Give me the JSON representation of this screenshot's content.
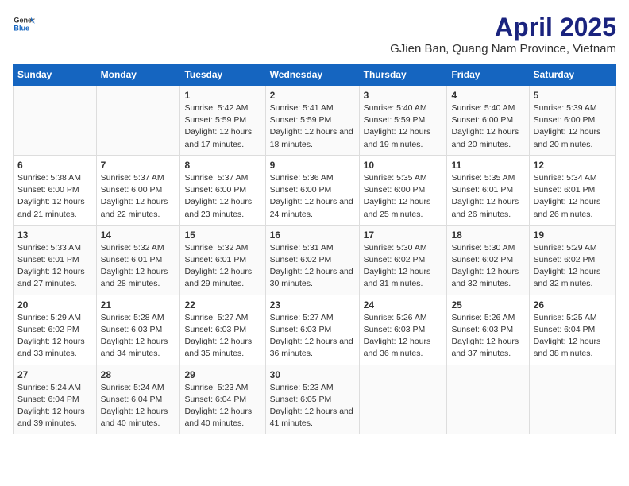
{
  "header": {
    "logo_general": "General",
    "logo_blue": "Blue",
    "title": "April 2025",
    "subtitle": "GJien Ban, Quang Nam Province, Vietnam"
  },
  "days_of_week": [
    "Sunday",
    "Monday",
    "Tuesday",
    "Wednesday",
    "Thursday",
    "Friday",
    "Saturday"
  ],
  "weeks": [
    [
      {
        "day": "",
        "info": ""
      },
      {
        "day": "",
        "info": ""
      },
      {
        "day": "1",
        "info": "Sunrise: 5:42 AM\nSunset: 5:59 PM\nDaylight: 12 hours and 17 minutes."
      },
      {
        "day": "2",
        "info": "Sunrise: 5:41 AM\nSunset: 5:59 PM\nDaylight: 12 hours and 18 minutes."
      },
      {
        "day": "3",
        "info": "Sunrise: 5:40 AM\nSunset: 5:59 PM\nDaylight: 12 hours and 19 minutes."
      },
      {
        "day": "4",
        "info": "Sunrise: 5:40 AM\nSunset: 6:00 PM\nDaylight: 12 hours and 20 minutes."
      },
      {
        "day": "5",
        "info": "Sunrise: 5:39 AM\nSunset: 6:00 PM\nDaylight: 12 hours and 20 minutes."
      }
    ],
    [
      {
        "day": "6",
        "info": "Sunrise: 5:38 AM\nSunset: 6:00 PM\nDaylight: 12 hours and 21 minutes."
      },
      {
        "day": "7",
        "info": "Sunrise: 5:37 AM\nSunset: 6:00 PM\nDaylight: 12 hours and 22 minutes."
      },
      {
        "day": "8",
        "info": "Sunrise: 5:37 AM\nSunset: 6:00 PM\nDaylight: 12 hours and 23 minutes."
      },
      {
        "day": "9",
        "info": "Sunrise: 5:36 AM\nSunset: 6:00 PM\nDaylight: 12 hours and 24 minutes."
      },
      {
        "day": "10",
        "info": "Sunrise: 5:35 AM\nSunset: 6:00 PM\nDaylight: 12 hours and 25 minutes."
      },
      {
        "day": "11",
        "info": "Sunrise: 5:35 AM\nSunset: 6:01 PM\nDaylight: 12 hours and 26 minutes."
      },
      {
        "day": "12",
        "info": "Sunrise: 5:34 AM\nSunset: 6:01 PM\nDaylight: 12 hours and 26 minutes."
      }
    ],
    [
      {
        "day": "13",
        "info": "Sunrise: 5:33 AM\nSunset: 6:01 PM\nDaylight: 12 hours and 27 minutes."
      },
      {
        "day": "14",
        "info": "Sunrise: 5:32 AM\nSunset: 6:01 PM\nDaylight: 12 hours and 28 minutes."
      },
      {
        "day": "15",
        "info": "Sunrise: 5:32 AM\nSunset: 6:01 PM\nDaylight: 12 hours and 29 minutes."
      },
      {
        "day": "16",
        "info": "Sunrise: 5:31 AM\nSunset: 6:02 PM\nDaylight: 12 hours and 30 minutes."
      },
      {
        "day": "17",
        "info": "Sunrise: 5:30 AM\nSunset: 6:02 PM\nDaylight: 12 hours and 31 minutes."
      },
      {
        "day": "18",
        "info": "Sunrise: 5:30 AM\nSunset: 6:02 PM\nDaylight: 12 hours and 32 minutes."
      },
      {
        "day": "19",
        "info": "Sunrise: 5:29 AM\nSunset: 6:02 PM\nDaylight: 12 hours and 32 minutes."
      }
    ],
    [
      {
        "day": "20",
        "info": "Sunrise: 5:29 AM\nSunset: 6:02 PM\nDaylight: 12 hours and 33 minutes."
      },
      {
        "day": "21",
        "info": "Sunrise: 5:28 AM\nSunset: 6:03 PM\nDaylight: 12 hours and 34 minutes."
      },
      {
        "day": "22",
        "info": "Sunrise: 5:27 AM\nSunset: 6:03 PM\nDaylight: 12 hours and 35 minutes."
      },
      {
        "day": "23",
        "info": "Sunrise: 5:27 AM\nSunset: 6:03 PM\nDaylight: 12 hours and 36 minutes."
      },
      {
        "day": "24",
        "info": "Sunrise: 5:26 AM\nSunset: 6:03 PM\nDaylight: 12 hours and 36 minutes."
      },
      {
        "day": "25",
        "info": "Sunrise: 5:26 AM\nSunset: 6:03 PM\nDaylight: 12 hours and 37 minutes."
      },
      {
        "day": "26",
        "info": "Sunrise: 5:25 AM\nSunset: 6:04 PM\nDaylight: 12 hours and 38 minutes."
      }
    ],
    [
      {
        "day": "27",
        "info": "Sunrise: 5:24 AM\nSunset: 6:04 PM\nDaylight: 12 hours and 39 minutes."
      },
      {
        "day": "28",
        "info": "Sunrise: 5:24 AM\nSunset: 6:04 PM\nDaylight: 12 hours and 40 minutes."
      },
      {
        "day": "29",
        "info": "Sunrise: 5:23 AM\nSunset: 6:04 PM\nDaylight: 12 hours and 40 minutes."
      },
      {
        "day": "30",
        "info": "Sunrise: 5:23 AM\nSunset: 6:05 PM\nDaylight: 12 hours and 41 minutes."
      },
      {
        "day": "",
        "info": ""
      },
      {
        "day": "",
        "info": ""
      },
      {
        "day": "",
        "info": ""
      }
    ]
  ]
}
